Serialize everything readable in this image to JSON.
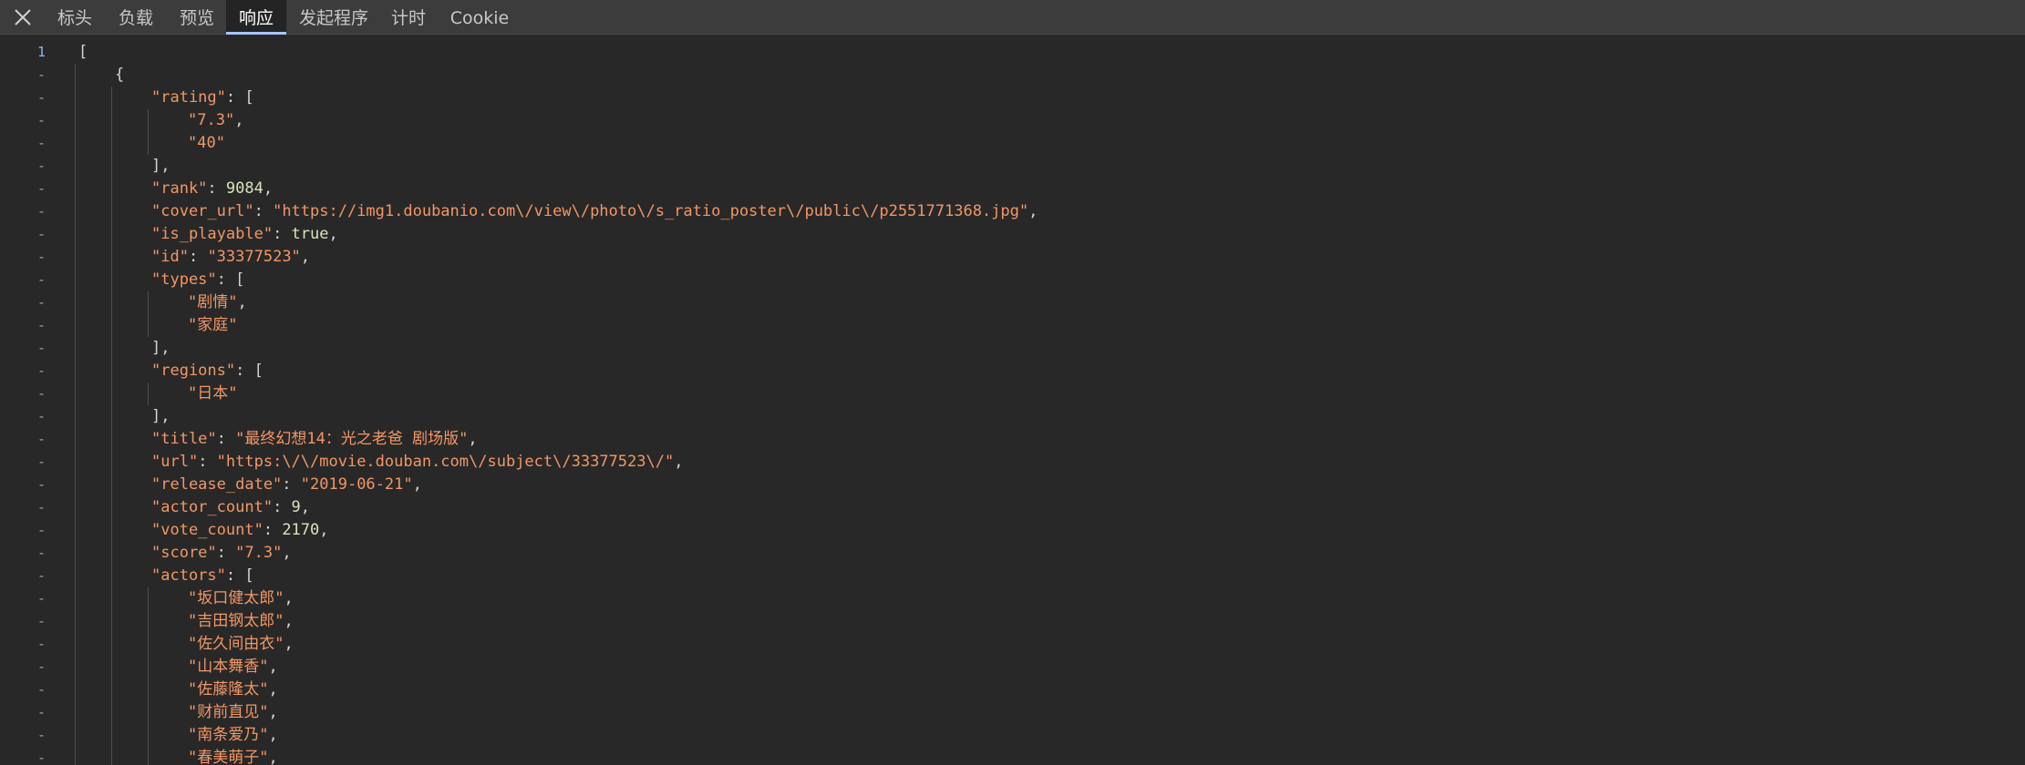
{
  "tabs": [
    {
      "label": "标头",
      "active": false
    },
    {
      "label": "负载",
      "active": false
    },
    {
      "label": "预览",
      "active": false
    },
    {
      "label": "响应",
      "active": true
    },
    {
      "label": "发起程序",
      "active": false
    },
    {
      "label": "计时",
      "active": false
    },
    {
      "label": "Cookie",
      "active": false
    }
  ],
  "close_icon": "close-icon",
  "colors": {
    "background": "#282828",
    "tabbar": "#3c3c3c",
    "active_tab_underline": "#a8c7fa",
    "json_key": "#f29766",
    "json_string": "#f29766",
    "json_number": "#d7e5ba",
    "line_number_first": "#8ab4f8"
  },
  "lines": [
    {
      "gutter": "1",
      "indent": 0,
      "tokens": [
        [
          "p",
          "["
        ]
      ]
    },
    {
      "gutter": "-",
      "indent": 1,
      "tokens": [
        [
          "p",
          "{"
        ]
      ]
    },
    {
      "gutter": "-",
      "indent": 2,
      "tokens": [
        [
          "k",
          "\"rating\""
        ],
        [
          "p",
          ": ["
        ]
      ]
    },
    {
      "gutter": "-",
      "indent": 3,
      "tokens": [
        [
          "s",
          "\"7.3\""
        ],
        [
          "p",
          ","
        ]
      ]
    },
    {
      "gutter": "-",
      "indent": 3,
      "tokens": [
        [
          "s",
          "\"40\""
        ]
      ]
    },
    {
      "gutter": "-",
      "indent": 2,
      "tokens": [
        [
          "p",
          "],"
        ]
      ]
    },
    {
      "gutter": "-",
      "indent": 2,
      "tokens": [
        [
          "k",
          "\"rank\""
        ],
        [
          "p",
          ": "
        ],
        [
          "n",
          "9084"
        ],
        [
          "p",
          ","
        ]
      ]
    },
    {
      "gutter": "-",
      "indent": 2,
      "tokens": [
        [
          "k",
          "\"cover_url\""
        ],
        [
          "p",
          ": "
        ],
        [
          "s",
          "\"https://img1.doubanio.com\\/view\\/photo\\/s_ratio_poster\\/public\\/p2551771368.jpg\""
        ],
        [
          "p",
          ","
        ]
      ]
    },
    {
      "gutter": "-",
      "indent": 2,
      "tokens": [
        [
          "k",
          "\"is_playable\""
        ],
        [
          "p",
          ": "
        ],
        [
          "b",
          "true"
        ],
        [
          "p",
          ","
        ]
      ]
    },
    {
      "gutter": "-",
      "indent": 2,
      "tokens": [
        [
          "k",
          "\"id\""
        ],
        [
          "p",
          ": "
        ],
        [
          "s",
          "\"33377523\""
        ],
        [
          "p",
          ","
        ]
      ]
    },
    {
      "gutter": "-",
      "indent": 2,
      "tokens": [
        [
          "k",
          "\"types\""
        ],
        [
          "p",
          ": ["
        ]
      ]
    },
    {
      "gutter": "-",
      "indent": 3,
      "tokens": [
        [
          "s",
          "\"剧情\""
        ],
        [
          "p",
          ","
        ]
      ]
    },
    {
      "gutter": "-",
      "indent": 3,
      "tokens": [
        [
          "s",
          "\"家庭\""
        ]
      ]
    },
    {
      "gutter": "-",
      "indent": 2,
      "tokens": [
        [
          "p",
          "],"
        ]
      ]
    },
    {
      "gutter": "-",
      "indent": 2,
      "tokens": [
        [
          "k",
          "\"regions\""
        ],
        [
          "p",
          ": ["
        ]
      ]
    },
    {
      "gutter": "-",
      "indent": 3,
      "tokens": [
        [
          "s",
          "\"日本\""
        ]
      ]
    },
    {
      "gutter": "-",
      "indent": 2,
      "tokens": [
        [
          "p",
          "],"
        ]
      ]
    },
    {
      "gutter": "-",
      "indent": 2,
      "tokens": [
        [
          "k",
          "\"title\""
        ],
        [
          "p",
          ": "
        ],
        [
          "s",
          "\"最终幻想14：光之老爸 剧场版\""
        ],
        [
          "p",
          ","
        ]
      ]
    },
    {
      "gutter": "-",
      "indent": 2,
      "tokens": [
        [
          "k",
          "\"url\""
        ],
        [
          "p",
          ": "
        ],
        [
          "s",
          "\"https:\\/\\/movie.douban.com\\/subject\\/33377523\\/\""
        ],
        [
          "p",
          ","
        ]
      ]
    },
    {
      "gutter": "-",
      "indent": 2,
      "tokens": [
        [
          "k",
          "\"release_date\""
        ],
        [
          "p",
          ": "
        ],
        [
          "s",
          "\"2019-06-21\""
        ],
        [
          "p",
          ","
        ]
      ]
    },
    {
      "gutter": "-",
      "indent": 2,
      "tokens": [
        [
          "k",
          "\"actor_count\""
        ],
        [
          "p",
          ": "
        ],
        [
          "n",
          "9"
        ],
        [
          "p",
          ","
        ]
      ]
    },
    {
      "gutter": "-",
      "indent": 2,
      "tokens": [
        [
          "k",
          "\"vote_count\""
        ],
        [
          "p",
          ": "
        ],
        [
          "n",
          "2170"
        ],
        [
          "p",
          ","
        ]
      ]
    },
    {
      "gutter": "-",
      "indent": 2,
      "tokens": [
        [
          "k",
          "\"score\""
        ],
        [
          "p",
          ": "
        ],
        [
          "s",
          "\"7.3\""
        ],
        [
          "p",
          ","
        ]
      ]
    },
    {
      "gutter": "-",
      "indent": 2,
      "tokens": [
        [
          "k",
          "\"actors\""
        ],
        [
          "p",
          ": ["
        ]
      ]
    },
    {
      "gutter": "-",
      "indent": 3,
      "tokens": [
        [
          "s",
          "\"坂口健太郎\""
        ],
        [
          "p",
          ","
        ]
      ]
    },
    {
      "gutter": "-",
      "indent": 3,
      "tokens": [
        [
          "s",
          "\"吉田钢太郎\""
        ],
        [
          "p",
          ","
        ]
      ]
    },
    {
      "gutter": "-",
      "indent": 3,
      "tokens": [
        [
          "s",
          "\"佐久间由衣\""
        ],
        [
          "p",
          ","
        ]
      ]
    },
    {
      "gutter": "-",
      "indent": 3,
      "tokens": [
        [
          "s",
          "\"山本舞香\""
        ],
        [
          "p",
          ","
        ]
      ]
    },
    {
      "gutter": "-",
      "indent": 3,
      "tokens": [
        [
          "s",
          "\"佐藤隆太\""
        ],
        [
          "p",
          ","
        ]
      ]
    },
    {
      "gutter": "-",
      "indent": 3,
      "tokens": [
        [
          "s",
          "\"财前直见\""
        ],
        [
          "p",
          ","
        ]
      ]
    },
    {
      "gutter": "-",
      "indent": 3,
      "tokens": [
        [
          "s",
          "\"南条爱乃\""
        ],
        [
          "p",
          ","
        ]
      ]
    },
    {
      "gutter": "-",
      "indent": 3,
      "tokens": [
        [
          "s",
          "\"春美萌子\""
        ],
        [
          "p",
          ","
        ]
      ]
    }
  ]
}
